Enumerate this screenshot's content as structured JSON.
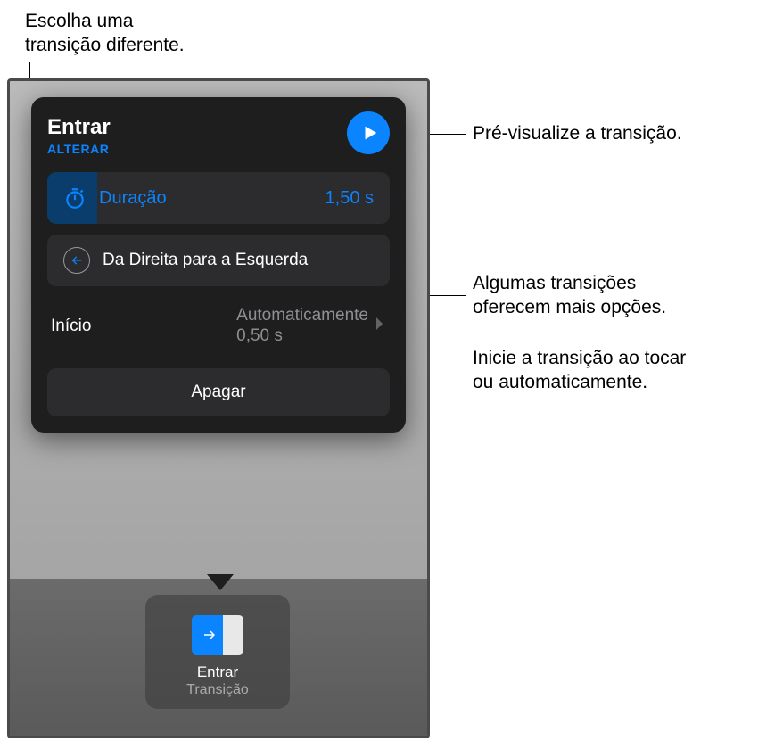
{
  "callouts": {
    "top_left": "Escolha uma\ntransição diferente.",
    "right_preview": "Pré-visualize a transição.",
    "right_options": "Algumas transições\noferecem mais opções.",
    "right_start": "Inicie a transição ao tocar\nou automaticamente."
  },
  "popover": {
    "title": "Entrar",
    "change": "ALTERAR",
    "duration": {
      "label": "Duração",
      "value": "1,50 s"
    },
    "direction": {
      "label": "Da Direita para a Esquerda"
    },
    "start": {
      "label": "Início",
      "value_line1": "Automaticamente",
      "value_line2": "0,50 s"
    },
    "delete": "Apagar"
  },
  "chip": {
    "title": "Entrar",
    "subtitle": "Transição"
  }
}
